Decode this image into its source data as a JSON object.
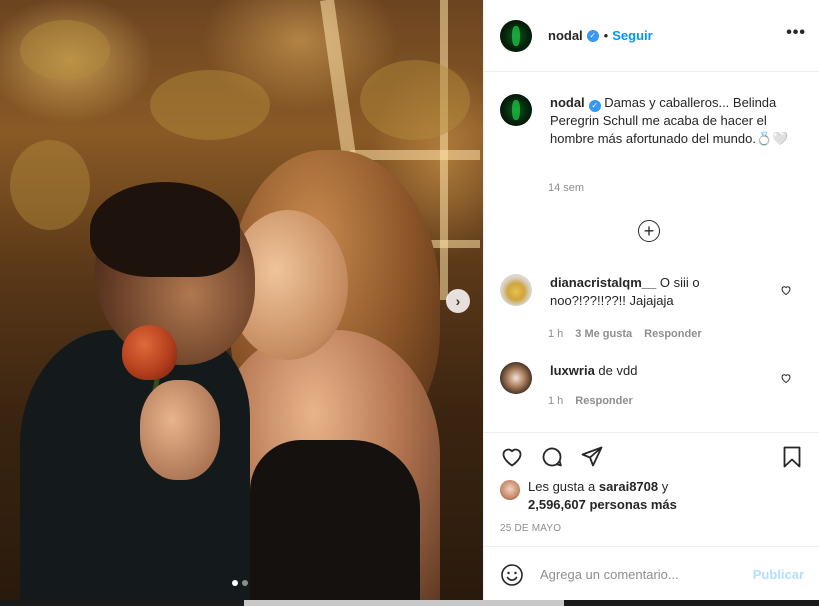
{
  "post": {
    "username": "nodal",
    "verified_icon": "verified-badge-icon",
    "separator": "•",
    "follow_label": "Seguir",
    "more_label": "•••",
    "caption": "Damas y caballeros... Belinda Peregrin Schull me acaba de hacer el hombre más afortunado del mundo.💍🤍",
    "caption_time": "14 sem",
    "load_more_icon": "plus-circle-icon",
    "load_more_label": "+"
  },
  "comments": [
    {
      "username": "dianacristalqm__",
      "text": "O siii o noo?!??!!??!! Jajajaja",
      "time": "1 h",
      "likes": "3 Me gusta",
      "reply_label": "Responder"
    },
    {
      "username": "luxwria",
      "text": "de vdd",
      "time": "1 h",
      "reply_label": "Responder"
    }
  ],
  "actions": {
    "icons": [
      "heart-icon",
      "comment-icon",
      "share-icon",
      "save-icon"
    ]
  },
  "likes": {
    "prefix": "Les gusta a",
    "user": "sarai8708",
    "connector": "y",
    "count": "2,596,607 personas más"
  },
  "date": "25 DE MAYO",
  "add_comment": {
    "placeholder": "Agrega un comentario...",
    "publish_label": "Publicar",
    "emoji_icon": "emoji-icon"
  },
  "carousel": {
    "next_label": "›",
    "slide_count": 2,
    "active_slide": 1
  },
  "colors": {
    "link_blue": "#0095f6",
    "verified_blue": "#3897f0",
    "publish_disabled": "#b2dffc",
    "muted_text": "#8e8e8e"
  }
}
